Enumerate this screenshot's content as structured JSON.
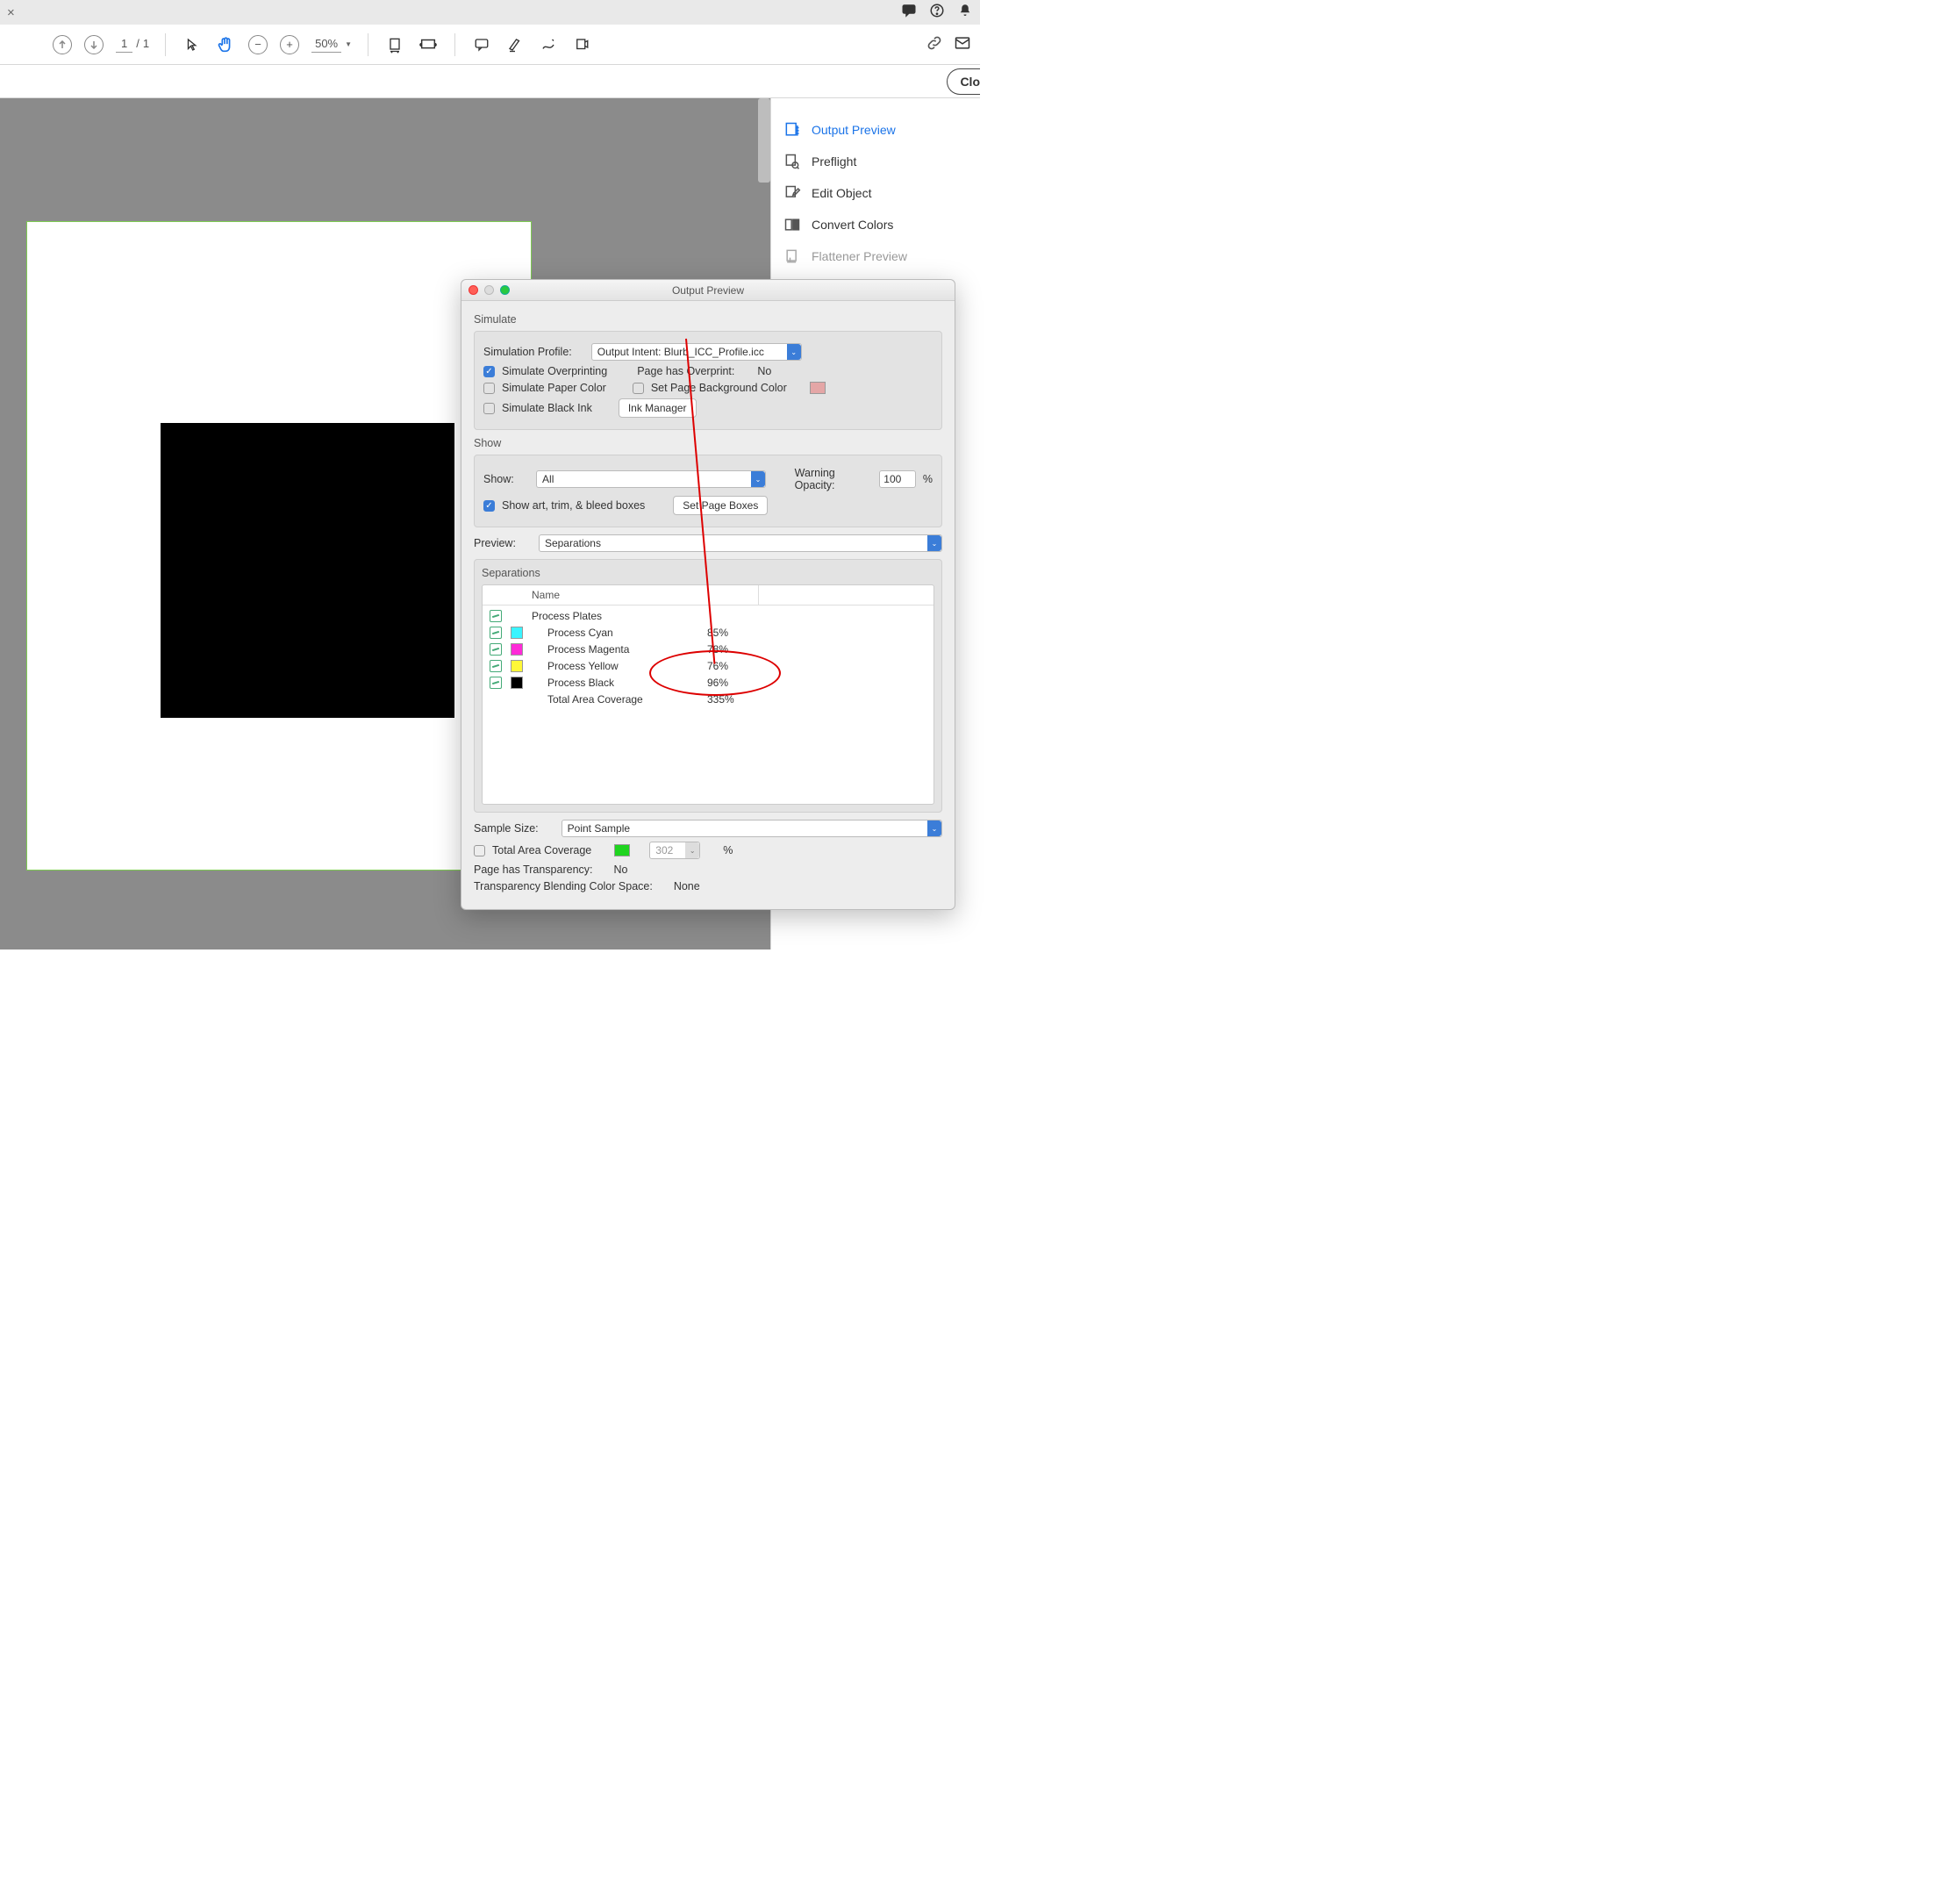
{
  "tabbar": {
    "close": "×"
  },
  "toolbar": {
    "page_current": "1",
    "page_sep": "/",
    "page_total": "1",
    "zoom_value": "50%"
  },
  "secondary": {
    "close_label": "Clo"
  },
  "sidepanel": {
    "items": [
      {
        "label": "Output Preview"
      },
      {
        "label": "Preflight"
      },
      {
        "label": "Edit Object"
      },
      {
        "label": "Convert Colors"
      },
      {
        "label": "Flattener Preview"
      }
    ]
  },
  "dialog": {
    "title": "Output Preview",
    "simulate_heading": "Simulate",
    "sim_profile_label": "Simulation Profile:",
    "sim_profile_value": "Output Intent: Blurb_ICC_Profile.icc",
    "simulate_overprinting": "Simulate Overprinting",
    "page_has_overprint_label": "Page has Overprint:",
    "page_has_overprint_value": "No",
    "simulate_paper_color": "Simulate Paper Color",
    "set_bg_color": "Set Page Background Color",
    "bg_swatch": "#e4a6a6",
    "simulate_black_ink": "Simulate Black Ink",
    "ink_manager": "Ink Manager",
    "show_heading": "Show",
    "show_label": "Show:",
    "show_value": "All",
    "warning_opacity_label": "Warning Opacity:",
    "warning_opacity_value": "100",
    "percent": "%",
    "show_boxes": "Show art, trim, & bleed boxes",
    "set_page_boxes": "Set Page Boxes",
    "preview_label": "Preview:",
    "preview_value": "Separations",
    "separations_heading": "Separations",
    "name_col": "Name",
    "rows": [
      {
        "color": "",
        "name": "Process Plates",
        "val": ""
      },
      {
        "color": "#3af4ff",
        "name": "Process Cyan",
        "val": "85%"
      },
      {
        "color": "#ff2ad8",
        "name": "Process Magenta",
        "val": "78%"
      },
      {
        "color": "#fff838",
        "name": "Process Yellow",
        "val": "76%"
      },
      {
        "color": "#000000",
        "name": "Process Black",
        "val": "96%"
      },
      {
        "color": "",
        "name": "Total Area Coverage",
        "val": "335%"
      }
    ],
    "sample_size_label": "Sample Size:",
    "sample_size_value": "Point Sample",
    "tac_label": "Total Area Coverage",
    "tac_swatch": "#1fd41f",
    "tac_value": "302",
    "transparency_label": "Page has Transparency:",
    "transparency_value": "No",
    "blend_space_label": "Transparency Blending Color Space:",
    "blend_space_value": "None"
  }
}
